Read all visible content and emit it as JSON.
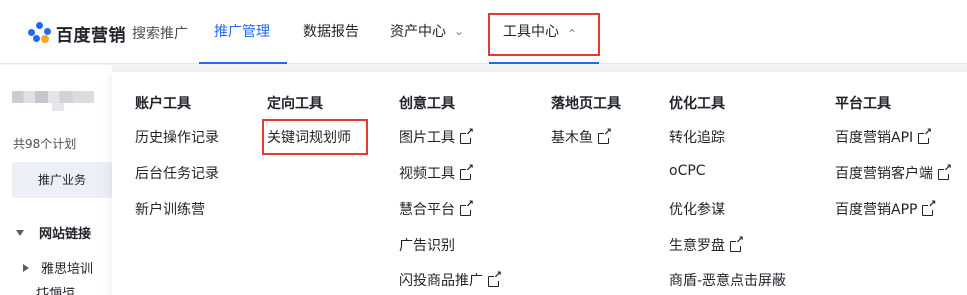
{
  "brand": {
    "logo_text": "百度营销",
    "product_name": "搜索推广"
  },
  "nav": {
    "tabs": [
      {
        "label": "推广管理"
      },
      {
        "label": "数据报告"
      },
      {
        "label": "资产中心"
      },
      {
        "label": "工具中心"
      }
    ]
  },
  "sidebar": {
    "plan_count": "共98个计划",
    "promote_button": "推广业务",
    "group_label": "网站链接",
    "item_label": "雅思培训",
    "cut_item_label": "托福培"
  },
  "tools_menu": {
    "columns": [
      {
        "title": "账户工具",
        "items": [
          {
            "label": "历史操作记录"
          },
          {
            "label": "后台任务记录"
          },
          {
            "label": "新户训练营"
          }
        ]
      },
      {
        "title": "定向工具",
        "items": [
          {
            "label": "关键词规划师"
          }
        ]
      },
      {
        "title": "创意工具",
        "items": [
          {
            "label": "图片工具"
          },
          {
            "label": "视频工具"
          },
          {
            "label": "慧合平台"
          },
          {
            "label": "广告识别"
          },
          {
            "label": "闪投商品推广"
          }
        ]
      },
      {
        "title": "落地页工具",
        "items": [
          {
            "label": "基木鱼"
          }
        ]
      },
      {
        "title": "优化工具",
        "items": [
          {
            "label": "转化追踪"
          },
          {
            "label": "oCPC"
          },
          {
            "label": "优化参谋"
          },
          {
            "label": "生意罗盘"
          },
          {
            "label": "商盾-恶意点击屏蔽"
          }
        ]
      },
      {
        "title": "平台工具",
        "items": [
          {
            "label": "百度营销API"
          },
          {
            "label": "百度营销客户端"
          },
          {
            "label": "百度营销APP"
          }
        ]
      }
    ]
  },
  "icons": {
    "external_link": "external-link-icon",
    "chevron_down": "chevron-down-icon",
    "chevron_up": "chevron-up-icon"
  },
  "colors": {
    "accent": "#2468f2",
    "highlight": "#e53935"
  }
}
